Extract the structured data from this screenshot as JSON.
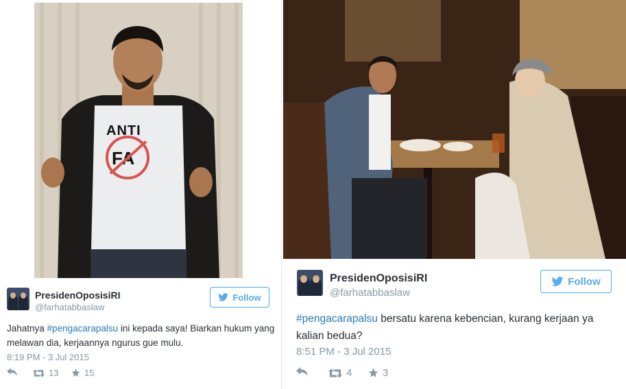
{
  "tweets": [
    {
      "display_name": "PresidenOposisiRI",
      "handle": "@farhatabbaslaw",
      "follow_label": "Follow",
      "text_before": "Jahatnya ",
      "hashtag": "#pengacarapalsu",
      "text_after": " ini kepada saya! Biarkan hukum yang melawan dia, kerjaannya ngurus gue mulu.",
      "timestamp": "8:19 PM - 3 Jul 2015",
      "retweets": "13",
      "favorites": "15",
      "photo": {
        "shirt_text_top": "ANTI",
        "shirt_text_main": "FA"
      }
    },
    {
      "display_name": "PresidenOposisiRI",
      "handle": "@farhatabbaslaw",
      "follow_label": "Follow",
      "text_before": "",
      "hashtag": "#pengacarapalsu",
      "text_after": " bersatu karena kebencian, kurang kerjaan ya kalian bedua?",
      "timestamp": "8:51 PM - 3 Jul 2015",
      "retweets": "4",
      "favorites": "3"
    }
  ],
  "colors": {
    "accent": "#55acee",
    "hashtag": "#2b7bb9",
    "muted": "#8899a6",
    "text": "#292f33"
  },
  "icons": [
    "reply-icon",
    "retweet-icon",
    "favorite-icon",
    "twitter-bird-icon"
  ]
}
